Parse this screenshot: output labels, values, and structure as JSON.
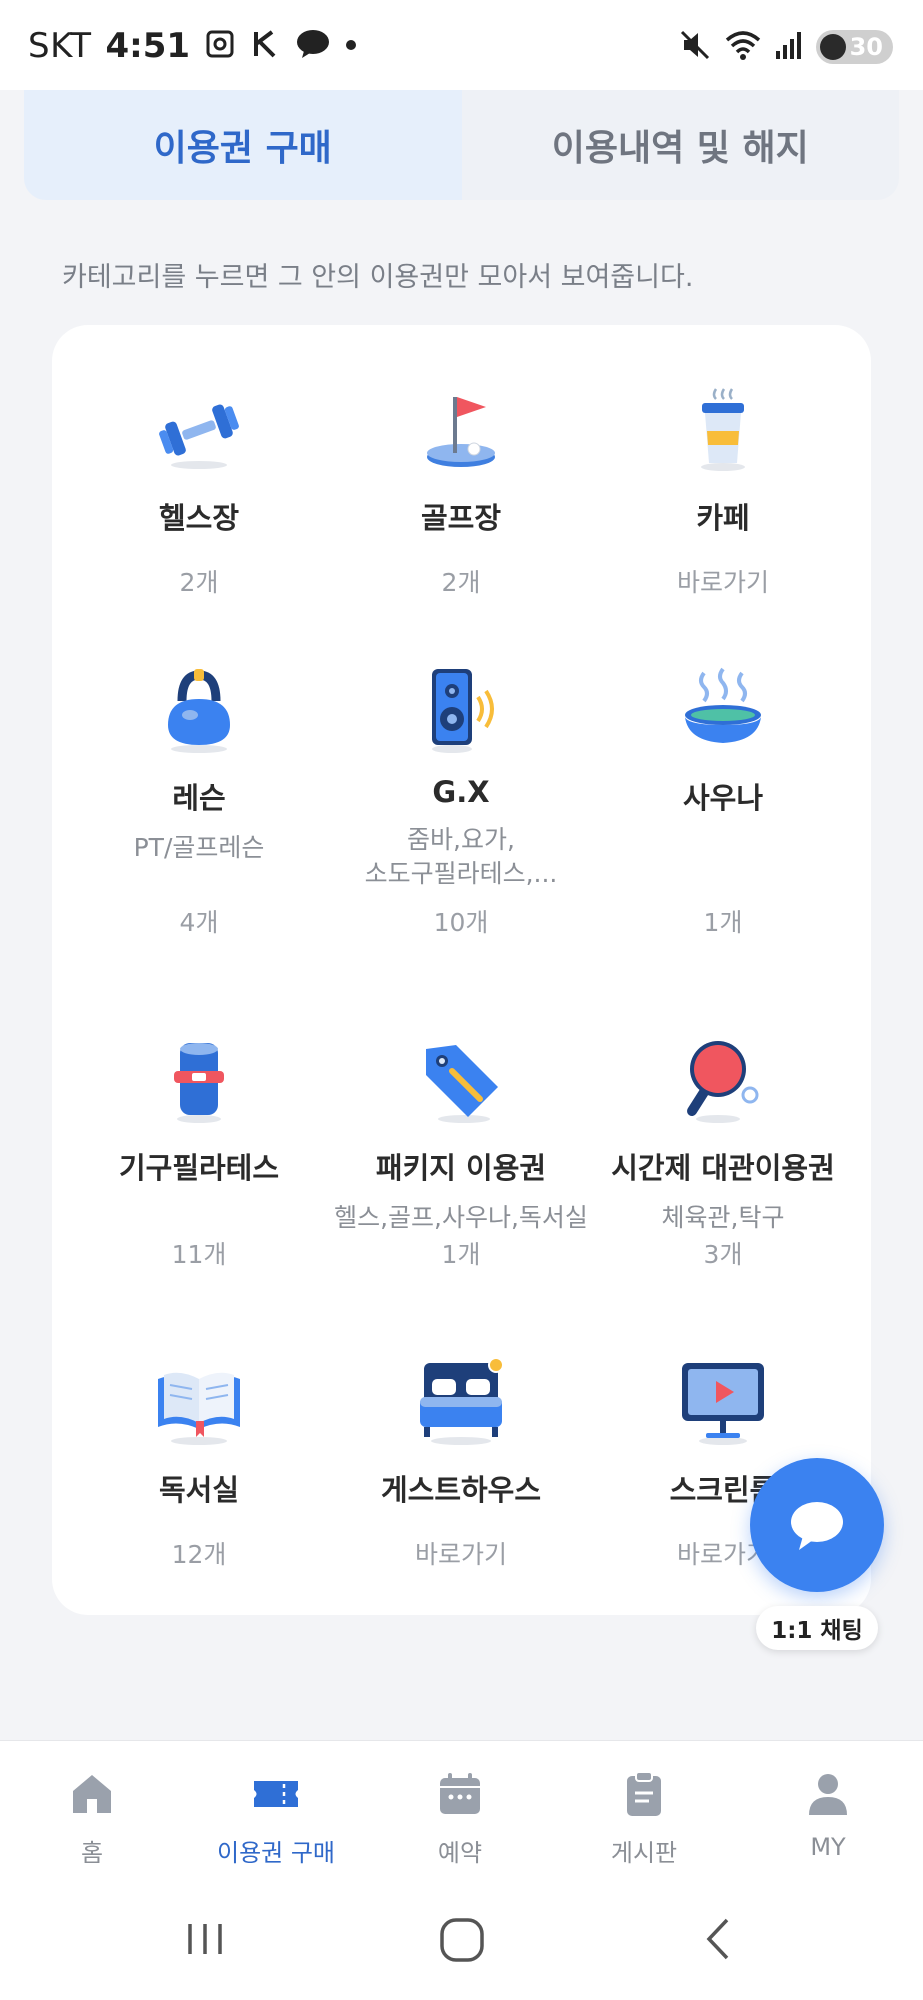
{
  "status_bar": {
    "carrier": "SKT",
    "time": "4:51",
    "battery": "30",
    "notification_icons": [
      "screenshot-icon",
      "k-icon",
      "kakaotalk-icon",
      "dot-icon"
    ],
    "right_icons": [
      "mute-icon",
      "wifi-icon",
      "signal-icon"
    ]
  },
  "tabs": [
    {
      "label": "이용권 구매",
      "active": true
    },
    {
      "label": "이용내역 및 해지",
      "active": false
    }
  ],
  "hint": "카테고리를 누르면 그 안의 이용권만 모아서 보여줍니다.",
  "categories": [
    {
      "name": "헬스장",
      "sub": "",
      "count": "2개",
      "icon": "dumbbell-icon"
    },
    {
      "name": "골프장",
      "sub": "",
      "count": "2개",
      "icon": "golf-flag-icon"
    },
    {
      "name": "카페",
      "sub": "",
      "count": "바로가기",
      "icon": "coffee-cup-icon"
    },
    {
      "name": "레슨",
      "sub": "PT/골프레슨",
      "count": "4개",
      "icon": "kettlebell-icon"
    },
    {
      "name": "G.X",
      "sub": "줌바,요가,\n소도구필라테스,...",
      "count": "10개",
      "icon": "speaker-icon"
    },
    {
      "name": "사우나",
      "sub": "",
      "count": "1개",
      "icon": "sauna-icon"
    },
    {
      "name": "기구필라테스",
      "sub": "",
      "count": "11개",
      "icon": "pilates-roller-icon"
    },
    {
      "name": "패키지 이용권",
      "sub": "헬스,골프,사우나,독서실",
      "count": "1개",
      "icon": "tag-icon"
    },
    {
      "name": "시간제 대관이용권",
      "sub": "체육관,탁구",
      "count": "3개",
      "icon": "ping-pong-icon"
    },
    {
      "name": "독서실",
      "sub": "",
      "count": "12개",
      "icon": "book-icon"
    },
    {
      "name": "게스트하우스",
      "sub": "",
      "count": "바로가기",
      "icon": "bed-icon"
    },
    {
      "name": "스크린룸",
      "sub": "",
      "count": "바로가기",
      "icon": "screen-icon"
    }
  ],
  "chat": {
    "label": "1:1 채팅",
    "icon": "chat-bubble-icon"
  },
  "bottom_nav": [
    {
      "label": "홈",
      "icon": "home-icon",
      "active": false
    },
    {
      "label": "이용권 구매",
      "icon": "ticket-icon",
      "active": true
    },
    {
      "label": "예약",
      "icon": "calendar-icon",
      "active": false
    },
    {
      "label": "게시판",
      "icon": "clipboard-icon",
      "active": false
    },
    {
      "label": "MY",
      "icon": "person-icon",
      "active": false
    }
  ],
  "system_nav": [
    "recents-icon",
    "home-circle-icon",
    "back-icon"
  ],
  "colors": {
    "accent": "#2f68c9",
    "fab": "#3b82f0",
    "background": "#f3f4f7"
  }
}
